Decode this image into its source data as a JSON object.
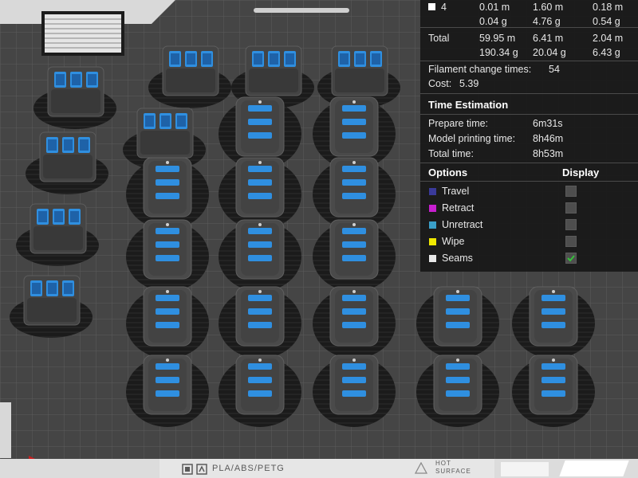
{
  "colors": {
    "bed": "#454545",
    "bed_grid": "#5c5c5c",
    "brim": "#151515",
    "part_body": "#4a4a4a",
    "part_accent": "#2f8fe0",
    "panel_bg": "#161616",
    "travel": "#3a3a9a",
    "retract": "#c81fd0",
    "unretract": "#3a9fc8",
    "wipe": "#f0e800",
    "seams": "#e8e8e8",
    "check_green": "#35c23a",
    "axis_red": "#c81e1e"
  },
  "filament_row": {
    "id": "4",
    "length_total": "0.01 m",
    "weight_total": "0.04 g",
    "length_model": "1.60 m",
    "weight_model": "4.76 g",
    "length_support": "0.18 m",
    "weight_support": "0.54 g"
  },
  "totals": {
    "label": "Total",
    "length_total": "59.95 m",
    "weight_total": "190.34 g",
    "length_model": "6.41 m",
    "weight_model": "20.04 g",
    "length_support": "2.04 m",
    "weight_support": "6.43 g"
  },
  "filament_change": {
    "label": "Filament change times:",
    "value": "54"
  },
  "cost": {
    "label": "Cost:",
    "value": "5.39"
  },
  "time_estimation": {
    "title": "Time Estimation",
    "rows": [
      {
        "label": "Prepare time:",
        "value": "6m31s"
      },
      {
        "label": "Model printing time:",
        "value": "8h46m"
      },
      {
        "label": "Total time:",
        "value": "8h53m"
      }
    ]
  },
  "options": {
    "title": "Options",
    "display_label": "Display",
    "items": [
      {
        "label": "Travel",
        "color": "#3a3a9a",
        "checked": false
      },
      {
        "label": "Retract",
        "color": "#c81fd0",
        "checked": false
      },
      {
        "label": "Unretract",
        "color": "#3a9fc8",
        "checked": false
      },
      {
        "label": "Wipe",
        "color": "#f0e800",
        "checked": false
      },
      {
        "label": "Seams",
        "color": "#e8e8e8",
        "checked": true
      }
    ]
  },
  "bed_label": "PLA/ABS/PETG",
  "hot_surface_lines": [
    "HOT",
    "SURFACE"
  ],
  "icons": [
    "filament-icon",
    "seams-checkmark-icon",
    "hot-surface-warning-icon",
    "bed-logo-icon"
  ]
}
